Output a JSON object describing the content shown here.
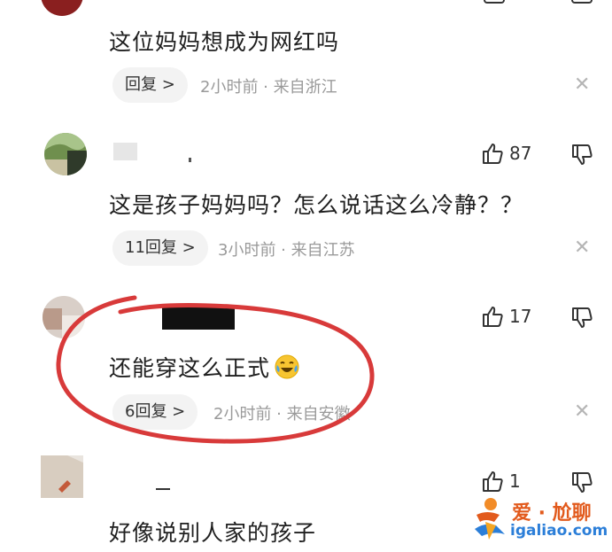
{
  "comments": [
    {
      "text": "这位妈妈想成为网红吗",
      "reply_label": "回复 >",
      "meta": "2小时前 · 来自浙江"
    },
    {
      "likes": "87",
      "text": "这是孩子妈妈吗？怎么说话这么冷静？？",
      "reply_label": "11回复 >",
      "meta": "3小时前 · 来自江苏"
    },
    {
      "likes": "17",
      "text": "还能穿这么正式",
      "reply_label": "6回复 >",
      "meta": "2小时前 · 来自安徽"
    },
    {
      "likes": "1",
      "text": "好像说别人家的孩子"
    }
  ],
  "icons": {
    "close": "close-icon",
    "like": "thumbs-up-icon",
    "dislike": "thumbs-down-icon",
    "emoji": "crying-laughing-emoji-icon"
  },
  "watermark": {
    "title": "爱 · 尬聊",
    "url": "igaliao.com"
  },
  "colors": {
    "annotation_circle": "#d83a3a",
    "watermark_orange": "#e25a1c",
    "watermark_blue": "#2b7ed8"
  }
}
